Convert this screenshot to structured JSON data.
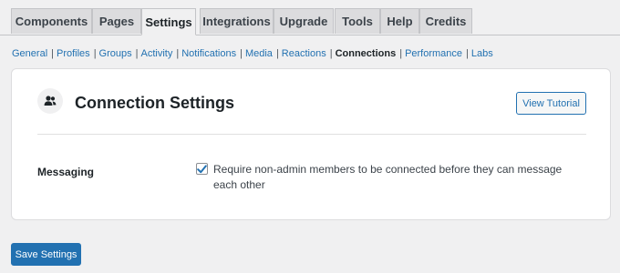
{
  "tabs": [
    {
      "label": "Components",
      "active": false
    },
    {
      "label": "Pages",
      "active": false
    },
    {
      "label": "Settings",
      "active": true
    },
    {
      "label": "Integrations",
      "active": false
    },
    {
      "label": "Upgrade",
      "active": false
    },
    {
      "label": "Tools",
      "active": false
    },
    {
      "label": "Help",
      "active": false
    },
    {
      "label": "Credits",
      "active": false
    }
  ],
  "subnav": {
    "items": [
      {
        "label": "General"
      },
      {
        "label": "Profiles"
      },
      {
        "label": "Groups"
      },
      {
        "label": "Activity"
      },
      {
        "label": "Notifications"
      },
      {
        "label": "Media"
      },
      {
        "label": "Reactions"
      },
      {
        "label": "Connections",
        "current": true
      },
      {
        "label": "Performance"
      },
      {
        "label": "Labs"
      }
    ],
    "separator": "|"
  },
  "panel": {
    "icon": "group-users-icon",
    "title": "Connection Settings",
    "tutorial_button": "View Tutorial",
    "field": {
      "label": "Messaging",
      "checkbox_checked": true,
      "checkbox_text": "Require non-admin members to be connected before they can message each other"
    }
  },
  "save_button": "Save Settings",
  "colors": {
    "accent": "#2271b1",
    "background": "#f0f0f1",
    "card": "#ffffff",
    "text": "#1d2327"
  }
}
